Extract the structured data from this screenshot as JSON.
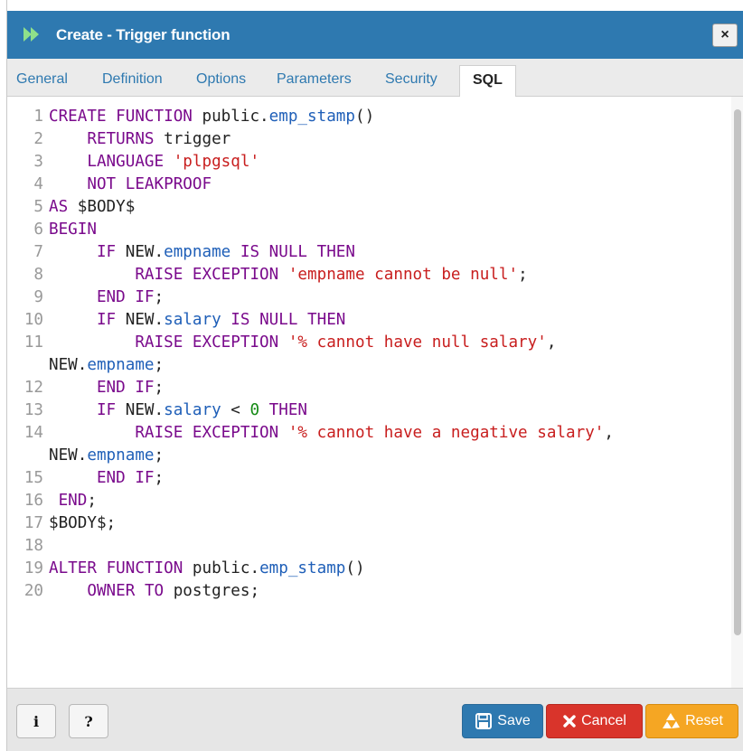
{
  "dialog": {
    "title": "Create - Trigger function",
    "close_label": "×"
  },
  "tabs": [
    {
      "label": "General"
    },
    {
      "label": "Definition"
    },
    {
      "label": "Options"
    },
    {
      "label": "Parameters"
    },
    {
      "label": "Security"
    },
    {
      "label": "SQL",
      "active": true
    }
  ],
  "editor": {
    "line_numbers": [
      "1",
      "2",
      "3",
      "4",
      "5",
      "6",
      "7",
      "8",
      "9",
      "10",
      "11",
      "12",
      "13",
      "14",
      "15",
      "16",
      "17",
      "18",
      "19",
      "20"
    ],
    "lines": [
      "CREATE FUNCTION public.emp_stamp()",
      "    RETURNS trigger",
      "    LANGUAGE 'plpgsql'",
      "    NOT LEAKPROOF",
      "AS $BODY$",
      "BEGIN",
      "     IF NEW.empname IS NULL THEN",
      "         RAISE EXCEPTION 'empname cannot be null';",
      "     END IF;",
      "     IF NEW.salary IS NULL THEN",
      "         RAISE EXCEPTION '% cannot have null salary',",
      "NEW.empname;",
      "     END IF;",
      "     IF NEW.salary < 0 THEN",
      "         RAISE EXCEPTION '% cannot have a negative salary',",
      "NEW.empname;",
      "     END IF;",
      " END;",
      "$BODY$;",
      "",
      "ALTER FUNCTION public.emp_stamp()",
      "    OWNER TO postgres;"
    ]
  },
  "footer": {
    "info_label": "i",
    "help_label": "?",
    "save_label": "Save",
    "cancel_label": "Cancel",
    "reset_label": "Reset"
  },
  "icons": {
    "title": "forward-arrows-icon",
    "save": "floppy-disk-icon",
    "cancel": "x-icon",
    "reset": "recycle-icon"
  },
  "colors": {
    "titlebar": "#2e79b0",
    "save": "#2e79b0",
    "cancel": "#d9342b",
    "reset": "#f5a623",
    "keyword": "#7a0a8c",
    "identifier": "#1f5fb8",
    "string": "#c81e1e",
    "number": "#148a14"
  }
}
